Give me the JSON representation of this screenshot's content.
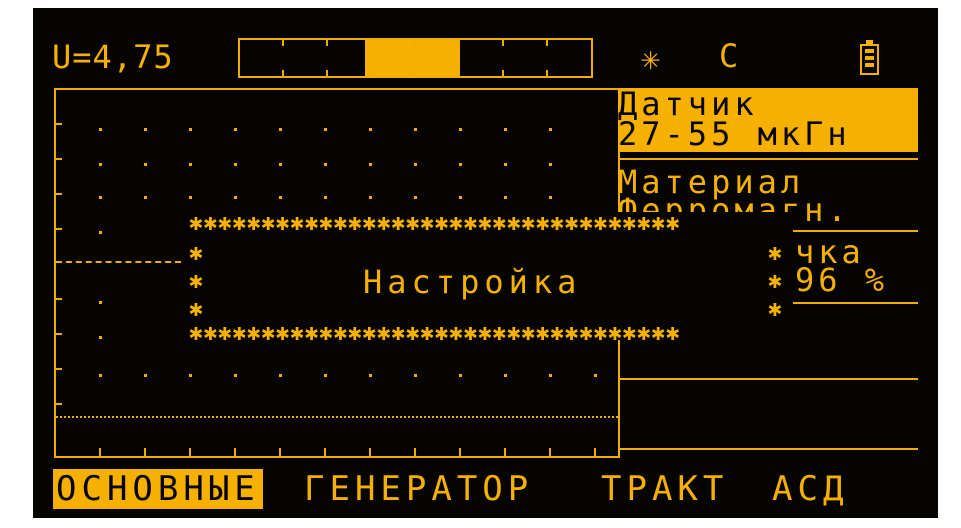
{
  "header": {
    "voltage": "U=4,75",
    "star_icon": "✳",
    "mode_label": "С",
    "battery_icon": "battery-icon"
  },
  "progress": {
    "fill_fraction": 0.36
  },
  "panels": {
    "sensor_label": "Датчик",
    "sensor_value": "27-55 мкГн",
    "material_label": "Материал",
    "material_value": "Ферромагн.",
    "partial_label": "чка",
    "partial_value": "96 %"
  },
  "modal": {
    "title": "Настройка"
  },
  "tabs": [
    "ОСНОВНЫЕ",
    "ГЕНЕРАТОР",
    "ТРАКТ",
    "АСД"
  ],
  "colors": {
    "foreground": "#f5b000",
    "background": "#050400"
  }
}
